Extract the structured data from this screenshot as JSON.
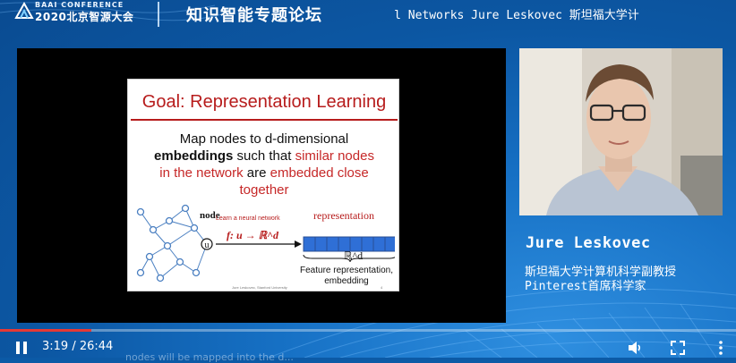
{
  "header": {
    "logo_top": "BAAI CONFERENCE",
    "logo_main": "2020北京智源大会",
    "title": "知识智能专题论坛",
    "ticker": "Graph Neural Networks Jure Leskovec  斯坦福大学计"
  },
  "slide": {
    "title": "Goal: Representation Learning",
    "body_1": "Map nodes to d-dimensional",
    "body_2_bold": "embeddings",
    "body_2_rest": " such that ",
    "body_2_red": "similar nodes",
    "body_3_red": "in the network",
    "body_3_mid": " are ",
    "body_3_red2": "embedded close",
    "body_4_red": "together",
    "node_label": "node",
    "node_letter": "u",
    "learn_label": "Learn a neural network",
    "function_label": "f: u → ℝ^d",
    "representation_label": "representation",
    "rd_label": "ℝ^d",
    "feature_label_1": "Feature representation,",
    "feature_label_2": "embedding",
    "footer": "Jure Leskovec, Stanford University",
    "page_number": "4"
  },
  "speaker": {
    "name": "Jure Leskovec",
    "title_line1": "斯坦福大学计算机科学副教授",
    "title_line2": "Pinterest首席科学家"
  },
  "player": {
    "current_time": "3:19",
    "duration": "26:44",
    "time_display": "3:19 / 26:44",
    "progress_fraction": 0.124,
    "subtitle_fragment": "nodes will be mapped into the d..."
  },
  "colors": {
    "accent_red": "#b71c1c",
    "progress_red": "#e53935",
    "background_blue": "#0c5aa6"
  },
  "icons": [
    "play-pause-icon",
    "volume-icon",
    "fullscreen-icon",
    "more-options-icon"
  ]
}
